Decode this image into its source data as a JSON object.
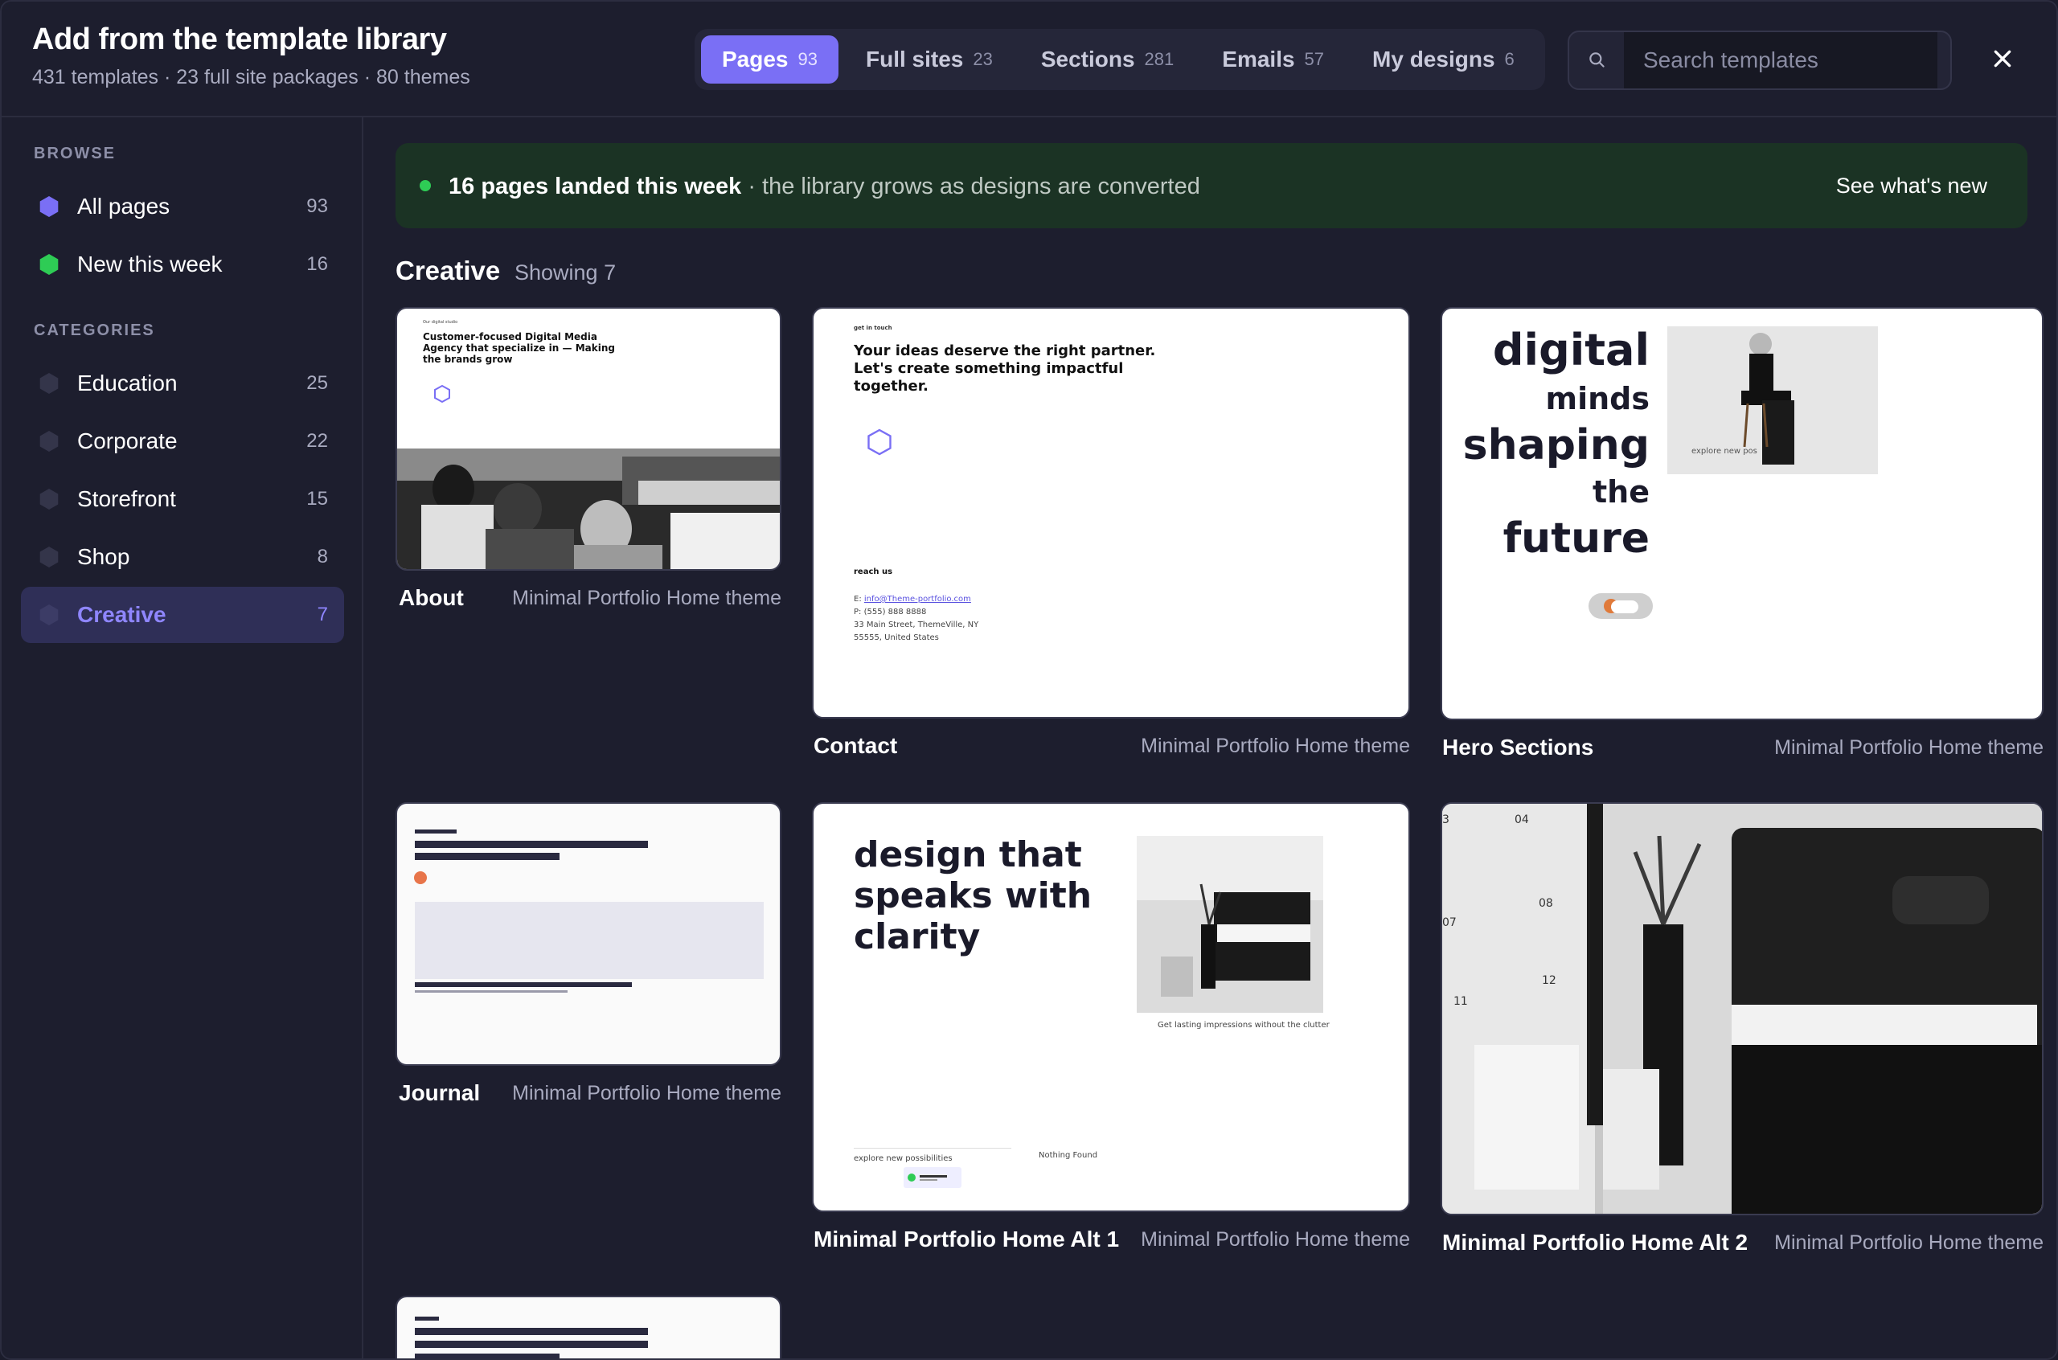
{
  "header": {
    "title": "Add from the template library",
    "subtitle": "431 templates · 23 full site packages · 80 themes",
    "tabs": [
      {
        "label": "Pages",
        "count": "93"
      },
      {
        "label": "Full sites",
        "count": "23"
      },
      {
        "label": "Sections",
        "count": "281"
      },
      {
        "label": "Emails",
        "count": "57"
      },
      {
        "label": "My designs",
        "count": "6"
      }
    ],
    "search_placeholder": "Search templates"
  },
  "sidebar": {
    "browse_heading": "BROWSE",
    "browse": [
      {
        "label": "All pages",
        "count": "93",
        "color": "#7a6ff5"
      },
      {
        "label": "New this week",
        "count": "16",
        "color": "#2ecc55"
      }
    ],
    "categories_heading": "CATEGORIES",
    "categories": [
      {
        "label": "Education",
        "count": "25"
      },
      {
        "label": "Corporate",
        "count": "22"
      },
      {
        "label": "Storefront",
        "count": "15"
      },
      {
        "label": "Shop",
        "count": "8"
      },
      {
        "label": "Creative",
        "count": "7"
      }
    ]
  },
  "banner": {
    "bold": "16 pages landed this week",
    "rest": " · the library grows as designs are converted",
    "link": "See what's new"
  },
  "section": {
    "title": "Creative",
    "showing": "Showing 7"
  },
  "cards": [
    {
      "name": "About",
      "theme": "Minimal Portfolio Home theme"
    },
    {
      "name": "Contact",
      "theme": "Minimal Portfolio Home theme"
    },
    {
      "name": "Hero Sections",
      "theme": "Minimal Portfolio Home theme"
    },
    {
      "name": "Journal",
      "theme": "Minimal Portfolio Home theme"
    },
    {
      "name": "Minimal Portfolio Home Alt 1",
      "theme": "Minimal Portfolio Home theme"
    },
    {
      "name": "Minimal Portfolio Home Alt 2",
      "theme": "Minimal Portfolio Home theme"
    }
  ],
  "previews": {
    "about": {
      "eyebrow": "Our digital studio",
      "headline": "Customer-focused Digital Media Agency that specialize in — Making the brands grow"
    },
    "contact": {
      "eyebrow": "get in touch",
      "headline": "Your ideas deserve the right partner. Let's create something impactful together.",
      "reach": "reach us",
      "email_prefix": "E: ",
      "email": "info@Theme-portfolio.com",
      "phone": "P: (555) 888 8888",
      "addr1": "33 Main Street, ThemeVille, NY",
      "addr2": "55555, United States"
    },
    "hero": {
      "w1": "digital",
      "w2": "minds",
      "w3": "shaping",
      "w4": "the",
      "w5": "future",
      "caption": "explore new pos"
    },
    "alt1": {
      "headline": "design that speaks with clarity",
      "caption": "Get lasting impressions without the clutter",
      "explore": "explore new possibilities",
      "nothing": "Nothing Found"
    },
    "alt2": {
      "n1": "04",
      "n2": "08",
      "n3": "07",
      "n4": "12",
      "n5": "11",
      "n6": "3"
    }
  },
  "colors": {
    "accent": "#7a6ff5",
    "green": "#2ecc55",
    "banner_bg": "#1b3324"
  }
}
